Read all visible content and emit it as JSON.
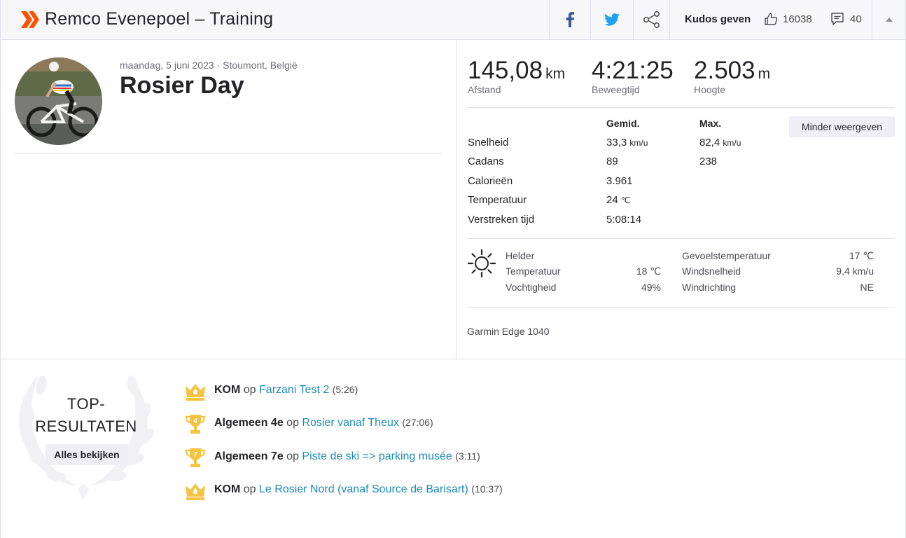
{
  "header": {
    "title": "Remco Evenepoel – Training",
    "kudos_label": "Kudos geven",
    "kudos_count": "16038",
    "comment_count": "40"
  },
  "activity": {
    "meta": "maandag, 5 juni 2023 · Stoumont, België",
    "title": "Rosier Day"
  },
  "stats": {
    "distance": {
      "value": "145,08",
      "unit": "km",
      "label": "Afstand"
    },
    "moving_time": {
      "value": "4:21:25",
      "label": "Beweegtijd"
    },
    "elevation": {
      "value": "2.503",
      "unit": "m",
      "label": "Hoogte"
    }
  },
  "table": {
    "col_avg": "Gemid.",
    "col_max": "Max.",
    "less_button": "Minder weergeven",
    "rows": [
      {
        "label": "Snelheid",
        "avg": "33,3",
        "avg_unit": "km/u",
        "max": "82,4",
        "max_unit": "km/u"
      },
      {
        "label": "Cadans",
        "avg": "89",
        "avg_unit": "",
        "max": "238",
        "max_unit": ""
      },
      {
        "label": "Calorieën",
        "avg": "3.961",
        "avg_unit": "",
        "max": "",
        "max_unit": ""
      },
      {
        "label": "Temperatuur",
        "avg": "24",
        "avg_unit": "℃",
        "max": "",
        "max_unit": ""
      },
      {
        "label": "Verstreken tijd",
        "avg": "5:08:14",
        "avg_unit": "",
        "max": "",
        "max_unit": ""
      }
    ]
  },
  "weather": {
    "condition": "Helder",
    "temperature_label": "Temperatuur",
    "temperature_value": "18 ℃",
    "humidity_label": "Vochtigheid",
    "humidity_value": "49%",
    "feels_label": "Gevoelstemperatuur",
    "feels_value": "17 ℃",
    "wind_speed_label": "Windsnelheid",
    "wind_speed_value": "9,4 km/u",
    "wind_dir_label": "Windrichting",
    "wind_dir_value": "NE"
  },
  "device": "Garmin Edge 1040",
  "top_results": {
    "title_line1": "TOP-",
    "title_line2": "RESULTATEN",
    "view_all": "Alles bekijken",
    "items": [
      {
        "badge": "crown",
        "rank": "KOM",
        "op": "op",
        "segment": "Farzani Test 2",
        "time": "(5:26)"
      },
      {
        "badge": "trophy-4",
        "badge_num": "4",
        "rank": "Algemeen 4e",
        "op": "op",
        "segment": "Rosier vanaf Theux",
        "time": "(27:06)"
      },
      {
        "badge": "trophy-7",
        "badge_num": "7",
        "rank": "Algemeen 7e",
        "op": "op",
        "segment": "Piste de ski => parking musée",
        "time": "(3:11)"
      },
      {
        "badge": "crown",
        "rank": "KOM",
        "op": "op",
        "segment": "Le Rosier Nord (vanaf Source de Barisart)",
        "time": "(10:37)"
      }
    ]
  },
  "colors": {
    "brand": "#fc5200",
    "link": "#1e8bb5",
    "gold": "#f5c242"
  }
}
